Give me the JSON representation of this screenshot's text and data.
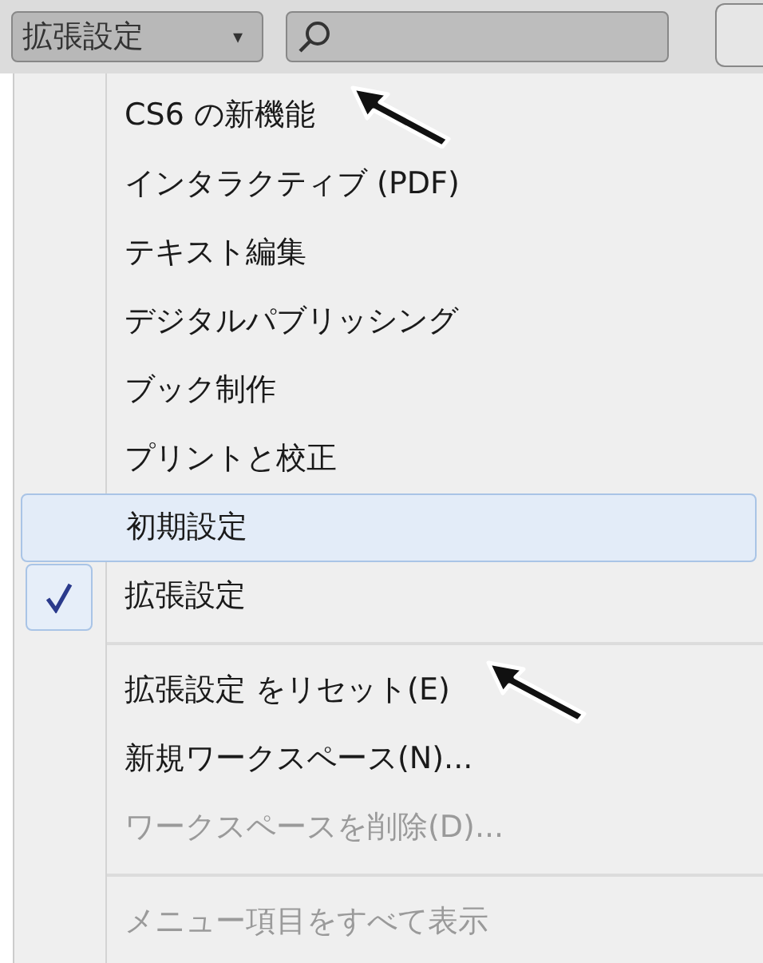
{
  "toolbar": {
    "workspace_button": {
      "label": "拡張設定",
      "caret": "▾"
    }
  },
  "menu": {
    "items": [
      {
        "kind": "item",
        "label": "CS6 の新機能",
        "highlighted": false,
        "checked": false,
        "disabled": false,
        "pointer": true
      },
      {
        "kind": "item",
        "label": "インタラクティブ (PDF)",
        "highlighted": false,
        "checked": false,
        "disabled": false,
        "pointer": false
      },
      {
        "kind": "item",
        "label": "テキスト編集",
        "highlighted": false,
        "checked": false,
        "disabled": false,
        "pointer": false
      },
      {
        "kind": "item",
        "label": "デジタルパブリッシング",
        "highlighted": false,
        "checked": false,
        "disabled": false,
        "pointer": false
      },
      {
        "kind": "item",
        "label": "ブック制作",
        "highlighted": false,
        "checked": false,
        "disabled": false,
        "pointer": false
      },
      {
        "kind": "item",
        "label": "プリントと校正",
        "highlighted": false,
        "checked": false,
        "disabled": false,
        "pointer": false
      },
      {
        "kind": "item",
        "label": "初期設定",
        "highlighted": true,
        "checked": false,
        "disabled": false,
        "pointer": false
      },
      {
        "kind": "item",
        "label": "拡張設定",
        "highlighted": false,
        "checked": true,
        "disabled": false,
        "pointer": false
      },
      {
        "kind": "separator"
      },
      {
        "kind": "item",
        "label": "拡張設定 をリセット(E)",
        "highlighted": false,
        "checked": false,
        "disabled": false,
        "pointer": true
      },
      {
        "kind": "item",
        "label": "新規ワークスペース(N)...",
        "highlighted": false,
        "checked": false,
        "disabled": false,
        "pointer": false
      },
      {
        "kind": "item",
        "label": "ワークスペースを削除(D)...",
        "highlighted": false,
        "checked": false,
        "disabled": true,
        "pointer": false
      },
      {
        "kind": "separator"
      },
      {
        "kind": "item",
        "label": "メニュー項目をすべて表示",
        "highlighted": false,
        "checked": false,
        "disabled": true,
        "pointer": false
      }
    ]
  }
}
